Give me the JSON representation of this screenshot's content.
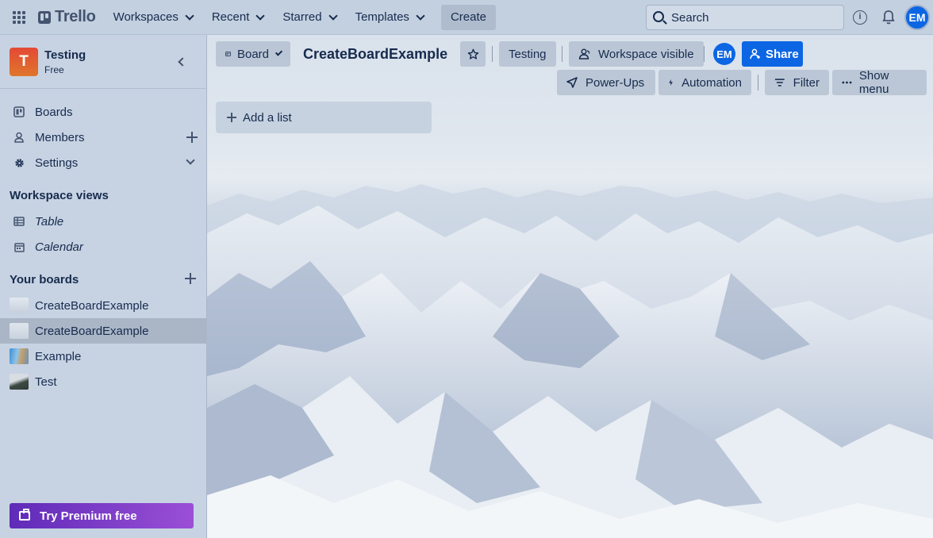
{
  "topnav": {
    "logo_text": "Trello",
    "menus": [
      "Workspaces",
      "Recent",
      "Starred",
      "Templates"
    ],
    "create_label": "Create",
    "search_placeholder": "Search",
    "avatar_initials": "EM",
    "icons": [
      "apps-grid-icon",
      "trello-logo-icon",
      "search-icon",
      "info-icon",
      "bell-icon"
    ]
  },
  "sidebar": {
    "workspace_initial": "T",
    "workspace_name": "Testing",
    "workspace_plan": "Free",
    "items": [
      {
        "label": "Boards",
        "icon": "boards-icon"
      },
      {
        "label": "Members",
        "icon": "members-icon"
      },
      {
        "label": "Settings",
        "icon": "settings-icon"
      }
    ],
    "views_heading": "Workspace views",
    "views": [
      {
        "label": "Table",
        "icon": "table-icon"
      },
      {
        "label": "Calendar",
        "icon": "calendar-icon"
      }
    ],
    "boards_heading": "Your boards",
    "boards": [
      {
        "label": "CreateBoardExample",
        "active": false
      },
      {
        "label": "CreateBoardExample",
        "active": true
      },
      {
        "label": "Example",
        "active": false
      },
      {
        "label": "Test",
        "active": false
      }
    ],
    "premium_label": "Try Premium free"
  },
  "board": {
    "view_label": "Board",
    "title": "CreateBoardExample",
    "workspace_label": "Testing",
    "visibility_label": "Workspace visible",
    "member_initials": "EM",
    "share_label": "Share",
    "powerups_label": "Power-Ups",
    "automation_label": "Automation",
    "filter_label": "Filter",
    "menu_label": "Show menu",
    "add_list_label": "Add a list"
  },
  "colors": {
    "accent": "#0c66e4",
    "workspace_logo": "#e34935",
    "premium": "#6e2fc4"
  }
}
